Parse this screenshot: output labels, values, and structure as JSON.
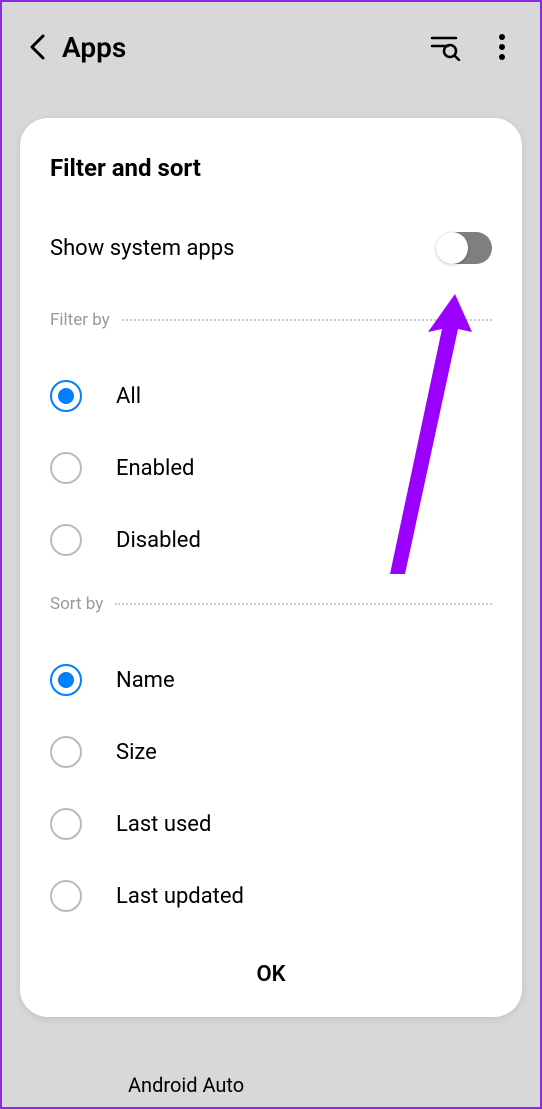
{
  "header": {
    "title": "Apps"
  },
  "dialog": {
    "title": "Filter and sort",
    "toggle": {
      "label": "Show system apps",
      "value": false
    },
    "filter": {
      "section_label": "Filter by",
      "selected": 0,
      "options": [
        {
          "label": "All"
        },
        {
          "label": "Enabled"
        },
        {
          "label": "Disabled"
        }
      ]
    },
    "sort": {
      "section_label": "Sort by",
      "selected": 0,
      "options": [
        {
          "label": "Name"
        },
        {
          "label": "Size"
        },
        {
          "label": "Last used"
        },
        {
          "label": "Last updated"
        }
      ]
    },
    "ok_label": "OK"
  },
  "background": {
    "app_name": "Android Auto"
  }
}
